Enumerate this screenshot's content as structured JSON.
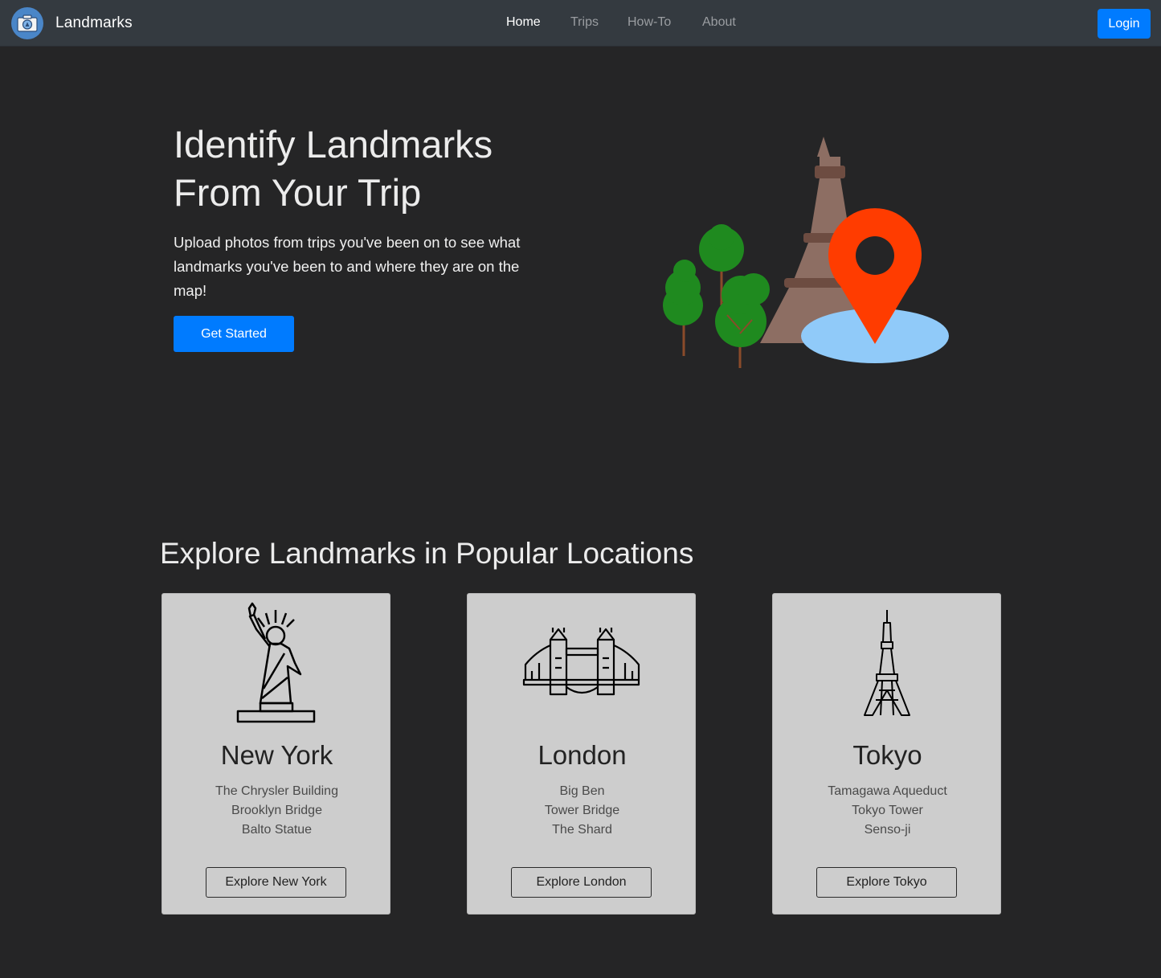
{
  "nav": {
    "brand": "Landmarks",
    "links": [
      {
        "label": "Home",
        "active": true
      },
      {
        "label": "Trips",
        "active": false
      },
      {
        "label": "How-To",
        "active": false
      },
      {
        "label": "About",
        "active": false
      }
    ],
    "login_label": "Login"
  },
  "hero": {
    "title_line1": "Identify Landmarks",
    "title_line2": "From Your Trip",
    "subtitle": "Upload photos from trips you've been on to see what landmarks you've been to and where they are on the map!",
    "cta_label": "Get Started"
  },
  "explore": {
    "title": "Explore Landmarks in Popular Locations",
    "cards": [
      {
        "city": "New York",
        "icon": "statue-of-liberty-icon",
        "landmarks": [
          "The Chrysler Building",
          "Brooklyn Bridge",
          "Balto Statue"
        ],
        "button": "Explore New York"
      },
      {
        "city": "London",
        "icon": "tower-bridge-icon",
        "landmarks": [
          "Big Ben",
          "Tower Bridge",
          "The Shard"
        ],
        "button": "Explore London"
      },
      {
        "city": "Tokyo",
        "icon": "tokyo-tower-icon",
        "landmarks": [
          "Tamagawa Aqueduct",
          "Tokyo Tower",
          "Senso-ji"
        ],
        "button": "Explore Tokyo"
      }
    ]
  },
  "colors": {
    "background": "#252526",
    "navbar": "#343a40",
    "primary": "#007bff",
    "card": "#cdcdcd",
    "pin": "#ff3c00"
  }
}
